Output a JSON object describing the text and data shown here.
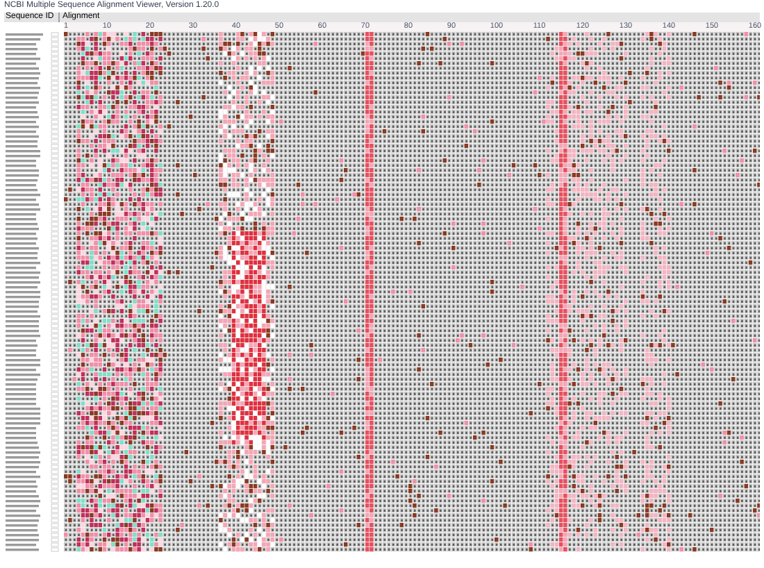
{
  "window": {
    "title": "NCBI Multiple Sequence Alignment Viewer, Version 1.20.0"
  },
  "headers": {
    "sequence_id": "Sequence ID",
    "alignment": "Alignment"
  },
  "ruler": [
    "1",
    "10",
    "20",
    "30",
    "40",
    "50",
    "60",
    "70",
    "80",
    "90",
    "100",
    "110",
    "120",
    "130",
    "140",
    "150",
    "160"
  ]
}
